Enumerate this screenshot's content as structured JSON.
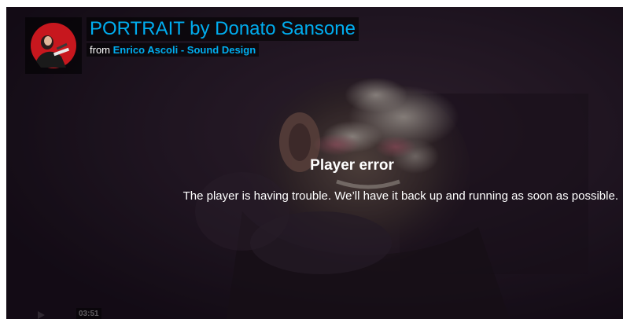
{
  "video": {
    "title": "PORTRAIT by Donato Sansone",
    "from_label": "from",
    "author": "Enrico Ascoli - Sound Design"
  },
  "error": {
    "title": "Player error",
    "message": "The player is having trouble. We’ll have it back up and running as soon as possible."
  },
  "controls": {
    "timecode": "03:51",
    "play_icon": "play-icon"
  },
  "colors": {
    "link": "#00adef",
    "avatar_red": "#c7171e",
    "background": "#1f1620"
  }
}
